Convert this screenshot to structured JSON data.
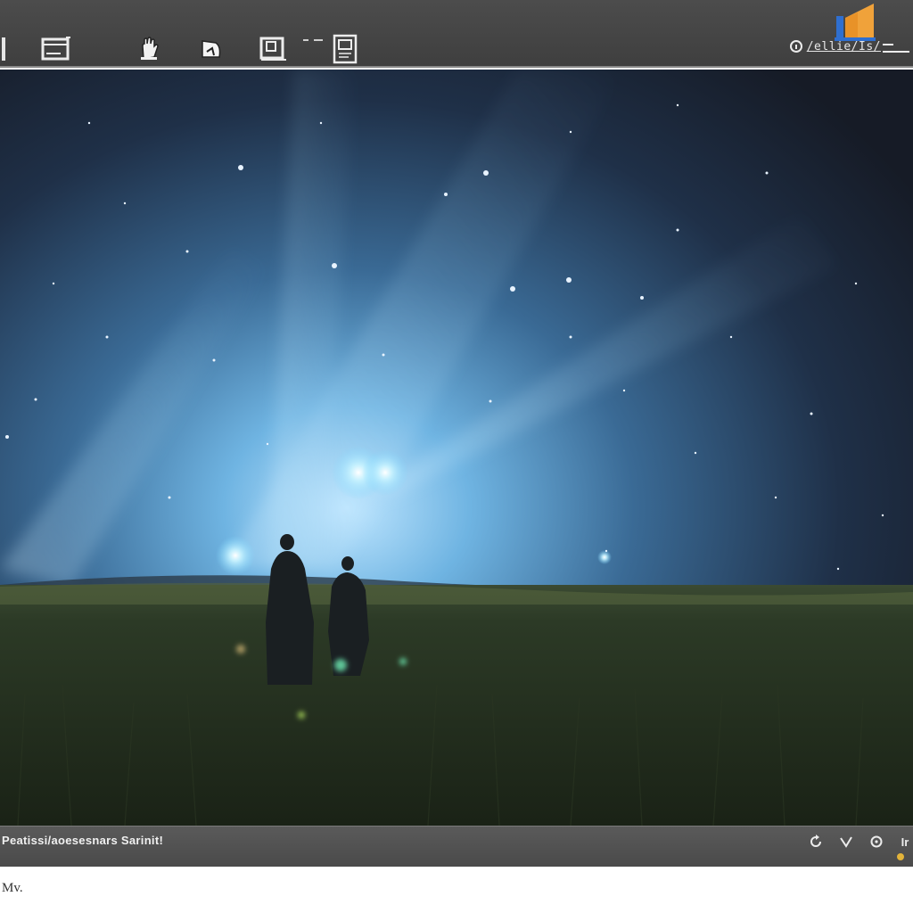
{
  "toolbar": {
    "tools": [
      {
        "name": "window-tool"
      },
      {
        "name": "hand-tool"
      },
      {
        "name": "pointer-tool"
      },
      {
        "name": "frame-tool"
      },
      {
        "name": "page-tool"
      }
    ],
    "status_text": "/ellie/Is/"
  },
  "viewport": {
    "scene": "night-field-scene"
  },
  "statusbar": {
    "caption": "Peatissi/aoesesnars Sarinit!",
    "right_label": "Ir"
  },
  "footer": {
    "text": "Mv."
  },
  "colors": {
    "toolbar_bg": "#444444",
    "statusbar_bg": "#525252",
    "logo_orange": "#f0a23a",
    "logo_blue": "#2f6fd0"
  }
}
